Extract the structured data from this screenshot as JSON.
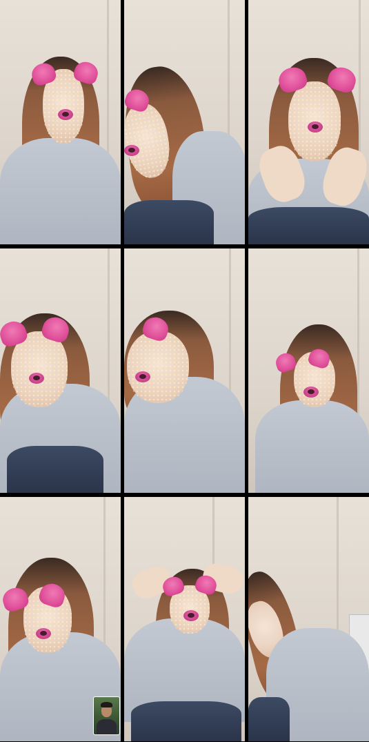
{
  "grid": {
    "tiles": [
      {
        "id": "tile-1",
        "filter": "dog-ears"
      },
      {
        "id": "tile-2",
        "filter": "dog-ears"
      },
      {
        "id": "tile-3",
        "filter": "dog-ears"
      },
      {
        "id": "tile-4",
        "filter": "dog-ears"
      },
      {
        "id": "tile-5",
        "filter": "dog-ears"
      },
      {
        "id": "tile-6",
        "filter": "dog-ears"
      },
      {
        "id": "tile-7",
        "filter": "dog-ears",
        "has_pip": true
      },
      {
        "id": "tile-8",
        "filter": "dog-ears"
      },
      {
        "id": "tile-9",
        "filter": "none"
      }
    ]
  },
  "colors": {
    "background": "#000000",
    "wall": "#e8e1d8",
    "filter_pink": "#e0509a",
    "shirt": "#b8bec8"
  }
}
